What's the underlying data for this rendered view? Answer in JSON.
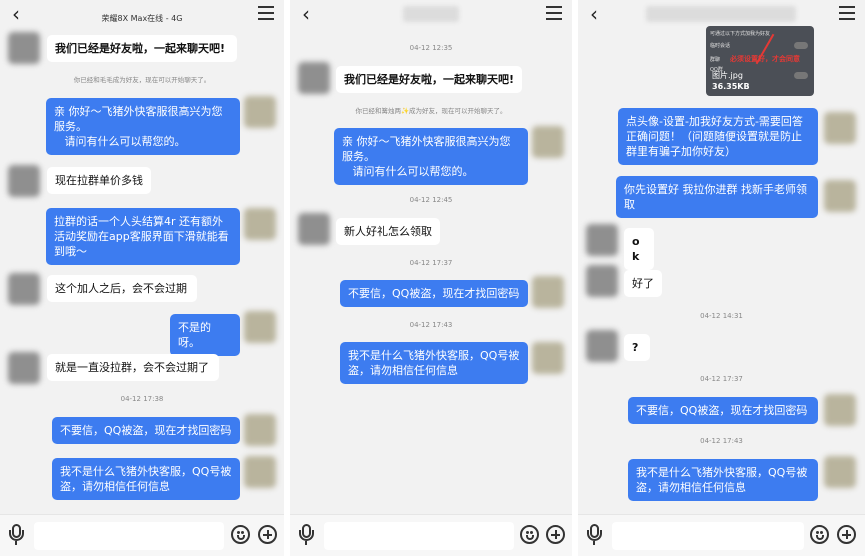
{
  "panel1": {
    "title": "荣耀8X Max在线 - 4G",
    "messages": [
      "我们已经是好友啦，一起来聊天吧!",
      "你已经和毛毛成为好友，现在可以开始聊天了。",
      "亲 你好～飞猪外快客服很高兴为您服务。\n   请问有什么可以帮您的。",
      "现在拉群单价多钱",
      "拉群的话一个人头结算4r 还有额外活动奖励在app客服界面下滑就能看到哦～",
      "这个加人之后，会不会过期",
      "不是的呀。",
      "就是一直没拉群，会不会过期了",
      "04-12 17:38",
      "不要信，QQ被盗，现在才找回密码",
      "我不是什么飞猪外快客服，QQ号被盗，请勿相信任何信息"
    ]
  },
  "panel2": {
    "messages": [
      "04-12 12:35",
      "我们已经是好友啦，一起来聊天吧!",
      "你已经和篝烛两✨成为好友，现在可以开始聊天了。",
      "亲 你好～飞猪外快客服很高兴为您服务。\n   请问有什么可以帮您的。",
      "04-12 12:45",
      "新人好礼怎么领取",
      "04-12 17:37",
      "不要信，QQ被盗，现在才找回密码",
      "04-12 17:43",
      "我不是什么飞猪外快客服，QQ号被盗，请勿相信任何信息"
    ]
  },
  "panel3": {
    "image": {
      "row1": "可通过以下方式加我为好友",
      "row2": "临时会话",
      "row3": "群聊",
      "row4": "QQ群",
      "note": "必须设置好，才会同意",
      "filename": "图片.jpg",
      "filesize": "36.35KB"
    },
    "messages": [
      "点头像-设置-加我好友方式-需要回答正确问题！（问题随便设置就是防止群里有骗子加你好友）",
      "你先设置好 我拉你进群 找新手老师领取",
      "ok",
      "好了",
      "04-12 14:31",
      "?",
      "04-12 17:37",
      "不要信，QQ被盗，现在才找回密码",
      "04-12 17:43",
      "我不是什么飞猪外快客服，QQ号被盗，请勿相信任何信息"
    ]
  },
  "icons": {
    "back": "back-arrow-icon",
    "menu": "hamburger-menu-icon",
    "voice": "microphone-icon",
    "emoji": "emoji-icon",
    "add": "plus-circle-icon"
  },
  "colors": {
    "outgoing_bubble": "#3d7cf0",
    "incoming_bubble": "#ffffff",
    "background": "#f2f2f2"
  }
}
